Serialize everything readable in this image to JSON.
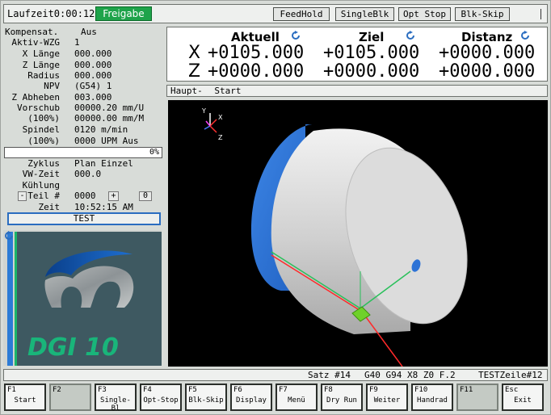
{
  "topbar": {
    "runtime": "Laufzeit0:00:12",
    "enable": "Freigabe",
    "buttons": [
      "FeedHold",
      "SingleBlk",
      "Opt Stop",
      "Blk-Skip"
    ]
  },
  "info": {
    "rows": [
      {
        "label": "Kompensat.",
        "value": "Aus"
      },
      {
        "label": "Aktiv-WZG",
        "value": "1"
      },
      {
        "label": "X Länge",
        "value": "000.000"
      },
      {
        "label": "Z Länge",
        "value": "000.000"
      },
      {
        "label": "Radius",
        "value": "000.000"
      },
      {
        "label": "NPV",
        "value": "(G54) 1"
      },
      {
        "label": "Z Abheben",
        "value": "003.000"
      },
      {
        "label": "Vorschub",
        "value": "00000.20 mm/U"
      },
      {
        "label": "(100%)",
        "value": "00000.00 mm/M"
      },
      {
        "label": "Spindel",
        "value": "0120 m/min"
      },
      {
        "label": "(100%)",
        "value": "0000 UPM Aus"
      }
    ],
    "progress": {
      "percent": 0,
      "text": "0%"
    },
    "rows2": [
      {
        "label": "Zyklus",
        "value": "Plan Einzel"
      },
      {
        "label": "VW-Zeit",
        "value": "000.0"
      },
      {
        "label": "Kühlung",
        "value": ""
      }
    ],
    "part": {
      "minus": "-",
      "label": "Teil #",
      "value": "0000",
      "plus": "+",
      "count": "0"
    },
    "time": {
      "label": "Zeit",
      "value": "10:52:15 AM"
    },
    "test_button": "TEST"
  },
  "logo": {
    "text": "DGI 10"
  },
  "dro": {
    "headers": [
      "Aktuell",
      "Ziel",
      "Distanz"
    ],
    "axes": [
      {
        "axis": "X",
        "actual": "+0105.000",
        "target": "+0105.000",
        "distance": "+0000.000"
      },
      {
        "axis": "Z",
        "actual": "+0000.000",
        "target": "+0000.000",
        "distance": "+0000.000"
      }
    ]
  },
  "program": {
    "mode": "Haupt-",
    "state": "Start"
  },
  "view": {
    "axes": [
      "Y",
      "X",
      "Z"
    ]
  },
  "status": {
    "block": "Satz #14",
    "gcodes": "G40 G94 X8 Z0 F.2",
    "program": "TESTZeile#12"
  },
  "fkeys": [
    {
      "key": "F1",
      "name": "Start",
      "enabled": true
    },
    {
      "key": "F2",
      "name": "",
      "enabled": false
    },
    {
      "key": "F3",
      "name": "Single-Bl",
      "enabled": true
    },
    {
      "key": "F4",
      "name": "Opt-Stop",
      "enabled": true
    },
    {
      "key": "F5",
      "name": "Blk-Skip",
      "enabled": true
    },
    {
      "key": "F6",
      "name": "Display",
      "enabled": true
    },
    {
      "key": "F7",
      "name": "Menü",
      "enabled": true
    },
    {
      "key": "F8",
      "name": "Dry Run",
      "enabled": true
    },
    {
      "key": "F9",
      "name": "Weiter",
      "enabled": true
    },
    {
      "key": "F10",
      "name": "Handrad",
      "enabled": true
    },
    {
      "key": "F11",
      "name": "",
      "enabled": false
    },
    {
      "key": "Esc",
      "name": "Exit",
      "enabled": true
    }
  ],
  "colors": {
    "accent": "#2a6dc0",
    "enable": "#1ea34a",
    "cylinder": "#d4d4d4",
    "chuck": "#2e73d6"
  }
}
